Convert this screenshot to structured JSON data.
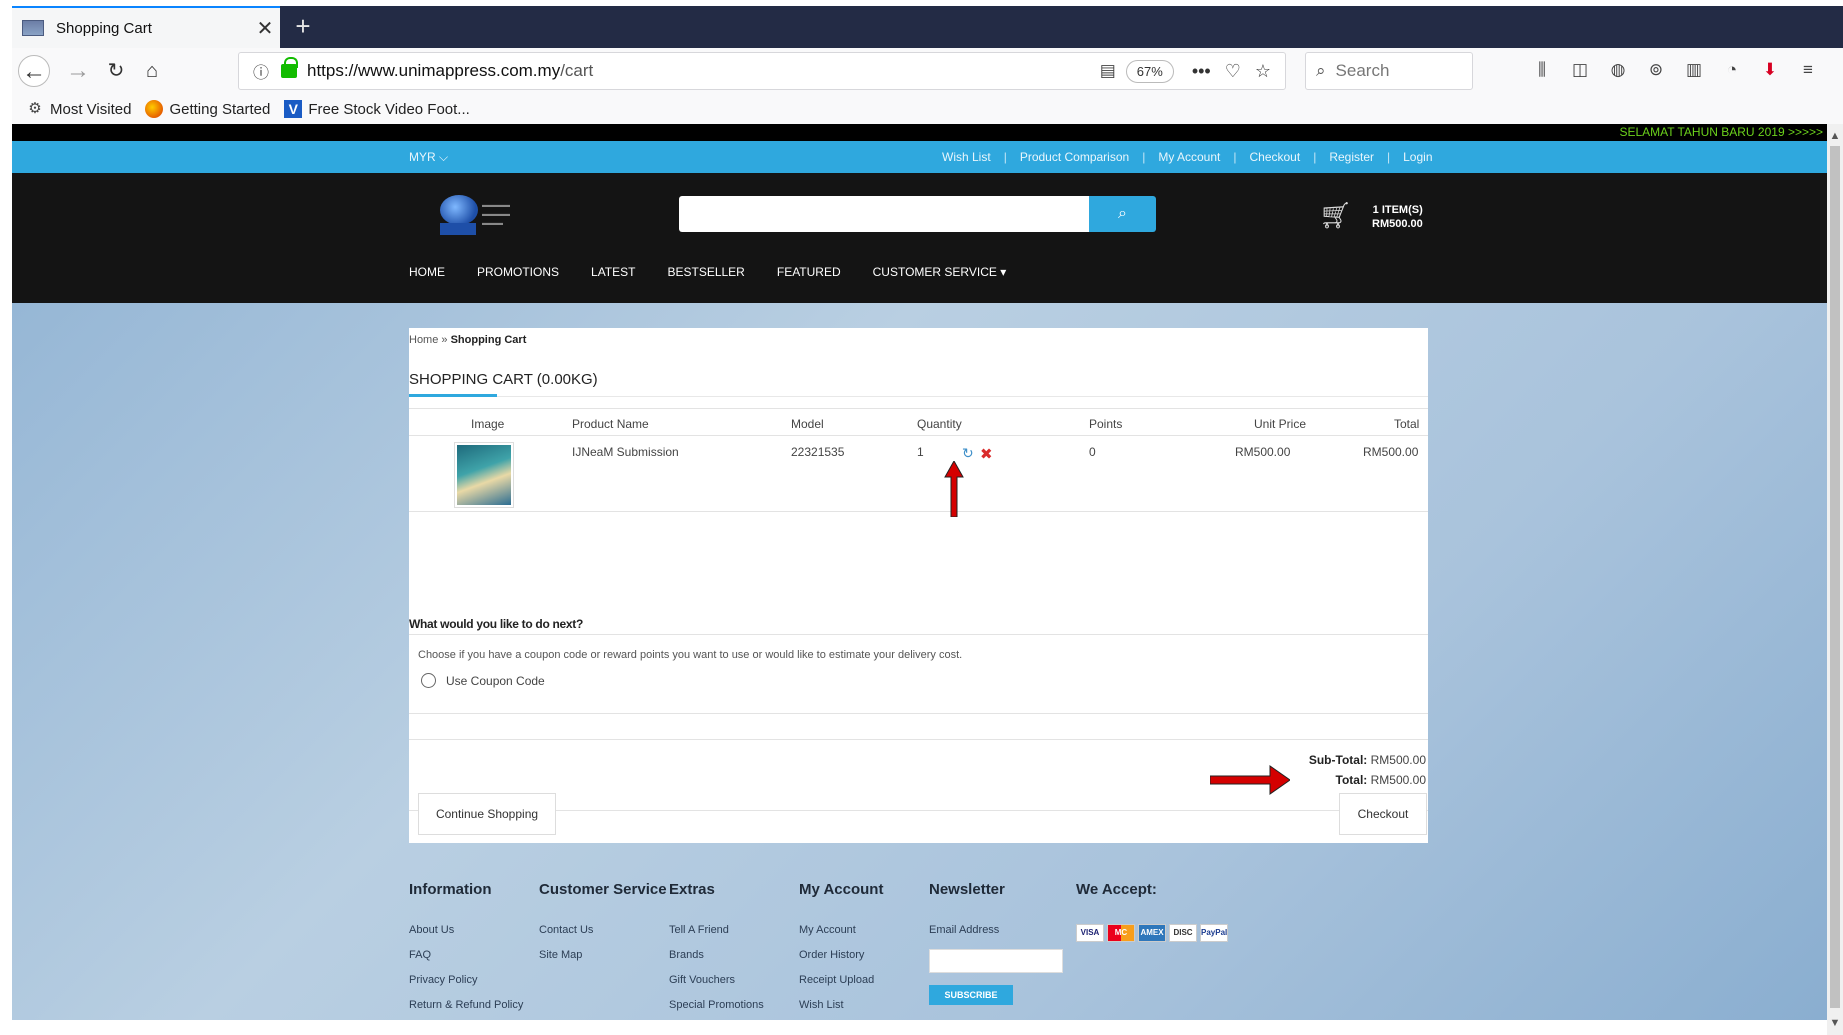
{
  "browser": {
    "tab_title": "Shopping Cart",
    "tab_close": "✕",
    "new_tab": "+",
    "url_host": "https://www.unimappress.com.my",
    "url_path": "/cart",
    "zoom": "67%",
    "search_placeholder": "Search",
    "bookmarks": [
      "Most Visited",
      "Getting Started",
      "Free Stock Video Foot..."
    ]
  },
  "site": {
    "announcement": "SELAMAT TAHUN BARU 2019 >>>>>",
    "currency": "MYR ⌵",
    "top_links": [
      "Wish List",
      "Product Comparison",
      "My Account",
      "Checkout",
      "Register",
      "Login"
    ],
    "cart_items": "1 ITEM(S)",
    "cart_total": "RM500.00",
    "main_menu": [
      "HOME",
      "PROMOTIONS",
      "LATEST",
      "BESTSELLER",
      "FEATURED",
      "CUSTOMER SERVICE ▾"
    ]
  },
  "breadcrumb": {
    "home": "Home",
    "sep": "»",
    "current": "Shopping Cart"
  },
  "page_title": "SHOPPING CART  (0.00KG)",
  "table": {
    "headers": [
      "Image",
      "Product Name",
      "Model",
      "Quantity",
      "Points",
      "Unit Price",
      "Total"
    ],
    "rows": [
      {
        "name": "IJNeaM Submission",
        "model": "22321535",
        "quantity": "1",
        "points": "0",
        "unit_price": "RM500.00",
        "total": "RM500.00"
      }
    ]
  },
  "next_step": {
    "heading": "What would you like to do next?",
    "description": "Choose if you have a coupon code or reward points you want to use or would like to estimate your delivery cost.",
    "coupon_label": "Use Coupon Code"
  },
  "totals": {
    "subtotal_label": "Sub-Total:",
    "subtotal_value": "RM500.00",
    "total_label": "Total:",
    "total_value": "RM500.00"
  },
  "buttons": {
    "continue": "Continue Shopping",
    "checkout": "Checkout"
  },
  "footer": {
    "information": {
      "title": "Information",
      "links": [
        "About Us",
        "FAQ",
        "Privacy Policy",
        "Return & Refund Policy"
      ]
    },
    "customer_service": {
      "title": "Customer Service",
      "links": [
        "Contact Us",
        "Site Map"
      ]
    },
    "extras": {
      "title": "Extras",
      "links": [
        "Tell A Friend",
        "Brands",
        "Gift Vouchers",
        "Special Promotions"
      ]
    },
    "my_account": {
      "title": "My Account",
      "links": [
        "My Account",
        "Order History",
        "Receipt Upload",
        "Wish List"
      ]
    },
    "newsletter": {
      "title": "Newsletter",
      "email_label": "Email Address",
      "subscribe": "SUBSCRIBE"
    },
    "we_accept": {
      "title": "We Accept:",
      "cards": [
        "VISA",
        "MC",
        "AMEX",
        "DISC",
        "PayPal"
      ]
    }
  },
  "colors": {
    "accent": "#2fa8de",
    "header_bg": "#141414",
    "annotation_arrow": "#d40000",
    "announcement_text": "#6bd11c"
  }
}
